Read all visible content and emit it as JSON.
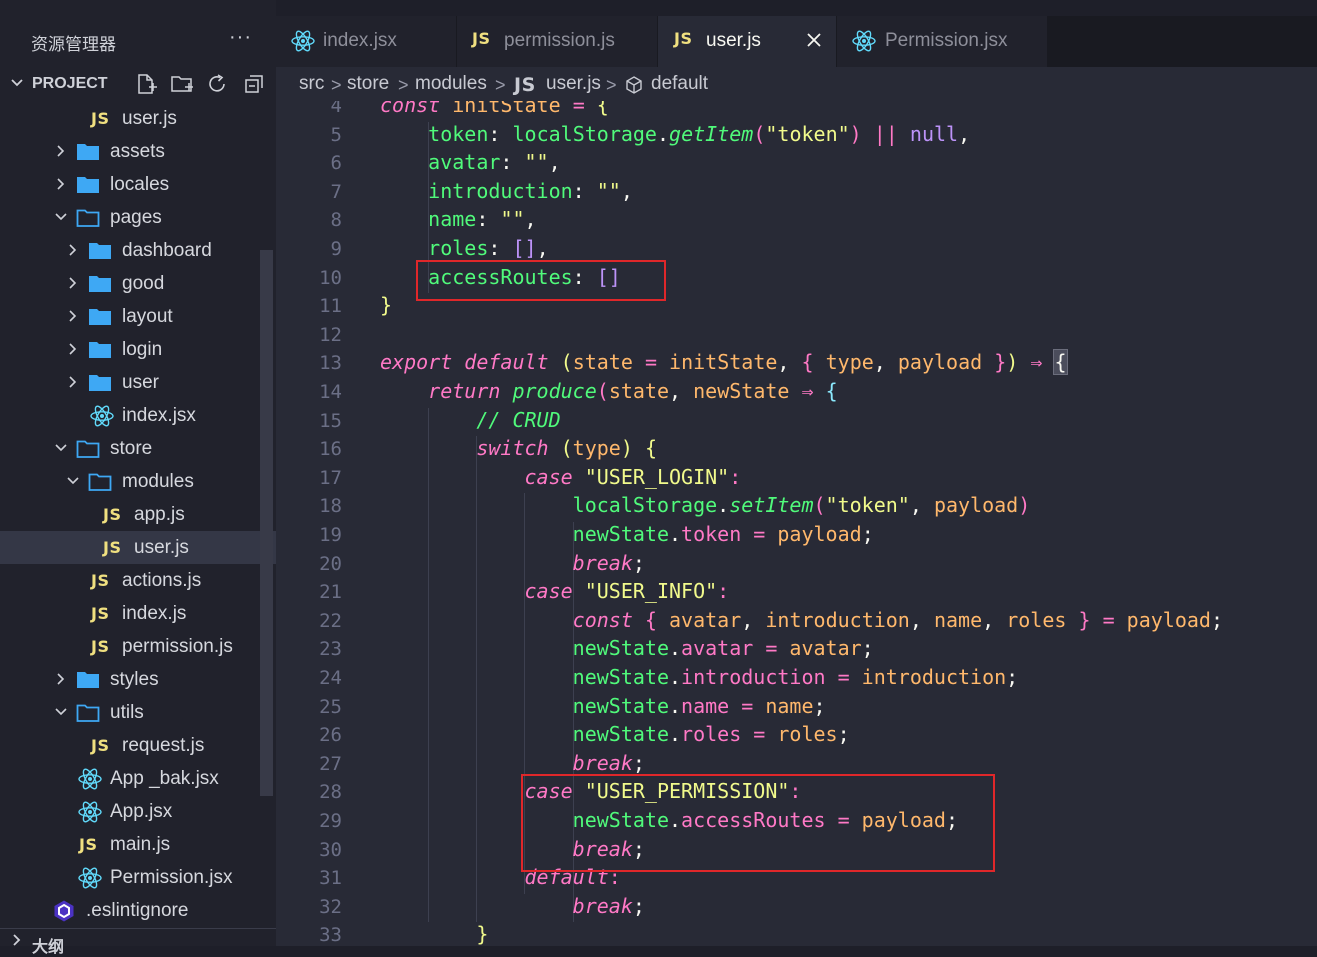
{
  "sidebar": {
    "title": "资源管理器",
    "more": "···",
    "project": "PROJECT",
    "outline": "大纲",
    "tree": [
      {
        "label": "user.js",
        "kind": "js",
        "depth": 2,
        "expanded": null
      },
      {
        "label": "assets",
        "kind": "folder",
        "depth": 1,
        "expanded": false
      },
      {
        "label": "locales",
        "kind": "folder",
        "depth": 1,
        "expanded": false
      },
      {
        "label": "pages",
        "kind": "folder",
        "depth": 1,
        "expanded": true
      },
      {
        "label": "dashboard",
        "kind": "folder",
        "depth": 2,
        "expanded": false
      },
      {
        "label": "good",
        "kind": "folder",
        "depth": 2,
        "expanded": false
      },
      {
        "label": "layout",
        "kind": "folder",
        "depth": 2,
        "expanded": false
      },
      {
        "label": "login",
        "kind": "folder",
        "depth": 2,
        "expanded": false
      },
      {
        "label": "user",
        "kind": "folder",
        "depth": 2,
        "expanded": false
      },
      {
        "label": "index.jsx",
        "kind": "react",
        "depth": 2,
        "expanded": null
      },
      {
        "label": "store",
        "kind": "folder",
        "depth": 1,
        "expanded": true
      },
      {
        "label": "modules",
        "kind": "folder",
        "depth": 2,
        "expanded": true
      },
      {
        "label": "app.js",
        "kind": "js",
        "depth": 3,
        "expanded": null
      },
      {
        "label": "user.js",
        "kind": "js",
        "depth": 3,
        "expanded": null,
        "selected": true
      },
      {
        "label": "actions.js",
        "kind": "js",
        "depth": 2,
        "expanded": null
      },
      {
        "label": "index.js",
        "kind": "js",
        "depth": 2,
        "expanded": null
      },
      {
        "label": "permission.js",
        "kind": "js",
        "depth": 2,
        "expanded": null
      },
      {
        "label": "styles",
        "kind": "folder",
        "depth": 1,
        "expanded": false
      },
      {
        "label": "utils",
        "kind": "folder",
        "depth": 1,
        "expanded": true
      },
      {
        "label": "request.js",
        "kind": "js",
        "depth": 2,
        "expanded": null
      },
      {
        "label": "App _bak.jsx",
        "kind": "react",
        "depth": 1,
        "expanded": null
      },
      {
        "label": "App.jsx",
        "kind": "react",
        "depth": 1,
        "expanded": null
      },
      {
        "label": "main.js",
        "kind": "js",
        "depth": 1,
        "expanded": null
      },
      {
        "label": "Permission.jsx",
        "kind": "react",
        "depth": 1,
        "expanded": null
      },
      {
        "label": ".eslintignore",
        "kind": "eslint",
        "depth": 0,
        "expanded": null
      }
    ]
  },
  "tabs": [
    {
      "label": "index.jsx",
      "kind": "react",
      "active": false
    },
    {
      "label": "permission.js",
      "kind": "js",
      "active": false
    },
    {
      "label": "user.js",
      "kind": "js",
      "active": true
    },
    {
      "label": "Permission.jsx",
      "kind": "react",
      "active": false
    }
  ],
  "js_badge": "JS",
  "breadcrumb": {
    "items": [
      "src",
      "store",
      "modules",
      "user.js",
      "default"
    ],
    "sep": ">"
  },
  "editor": {
    "line_numbers": [
      "4",
      "5",
      "6",
      "7",
      "8",
      "9",
      "10",
      "11",
      "12",
      "13",
      "14",
      "15",
      "16",
      "17",
      "18",
      "19",
      "20",
      "21",
      "22",
      "23",
      "24",
      "25",
      "26",
      "27",
      "28",
      "29",
      "30",
      "31",
      "32",
      "33"
    ],
    "lines": [
      [
        [
          "k",
          "const"
        ],
        [
          "pn",
          " "
        ],
        [
          "v",
          "initState"
        ],
        [
          "pn",
          " "
        ],
        [
          "o",
          "="
        ],
        [
          "pn",
          " "
        ],
        [
          "b1",
          "{"
        ]
      ],
      [
        [
          "pn",
          "    "
        ],
        [
          "p",
          "token"
        ],
        [
          "pn",
          ": "
        ],
        [
          "p",
          "localStorage"
        ],
        [
          "pn",
          "."
        ],
        [
          "f",
          "getItem"
        ],
        [
          "b2",
          "("
        ],
        [
          "s",
          "\"token\""
        ],
        [
          "b2",
          ")"
        ],
        [
          "pn",
          " "
        ],
        [
          "o",
          "||"
        ],
        [
          "pn",
          " "
        ],
        [
          "n",
          "null"
        ],
        [
          "pn",
          ","
        ]
      ],
      [
        [
          "pn",
          "    "
        ],
        [
          "p",
          "avatar"
        ],
        [
          "pn",
          ": "
        ],
        [
          "s",
          "\"\""
        ],
        [
          "pn",
          ","
        ]
      ],
      [
        [
          "pn",
          "    "
        ],
        [
          "p",
          "introduction"
        ],
        [
          "pn",
          ": "
        ],
        [
          "s",
          "\"\""
        ],
        [
          "pn",
          ","
        ]
      ],
      [
        [
          "pn",
          "    "
        ],
        [
          "p",
          "name"
        ],
        [
          "pn",
          ": "
        ],
        [
          "s",
          "\"\""
        ],
        [
          "pn",
          ","
        ]
      ],
      [
        [
          "pn",
          "    "
        ],
        [
          "p",
          "roles"
        ],
        [
          "pn",
          ": "
        ],
        [
          "n",
          "[]"
        ],
        [
          "pn",
          ","
        ]
      ],
      [
        [
          "pn",
          "    "
        ],
        [
          "p",
          "accessRoutes"
        ],
        [
          "pn",
          ": "
        ],
        [
          "n",
          "[]"
        ]
      ],
      [
        [
          "b1",
          "}"
        ]
      ],
      [
        [
          "pn",
          ""
        ]
      ],
      [
        [
          "k",
          "export"
        ],
        [
          "pn",
          " "
        ],
        [
          "k",
          "default"
        ],
        [
          "pn",
          " "
        ],
        [
          "b1",
          "("
        ],
        [
          "v",
          "state"
        ],
        [
          "pn",
          " "
        ],
        [
          "o",
          "="
        ],
        [
          "pn",
          " "
        ],
        [
          "v",
          "initState"
        ],
        [
          "pn",
          ", "
        ],
        [
          "b2",
          "{"
        ],
        [
          "pn",
          " "
        ],
        [
          "v",
          "type"
        ],
        [
          "pn",
          ", "
        ],
        [
          "v",
          "payload"
        ],
        [
          "pn",
          " "
        ],
        [
          "b2",
          "}"
        ],
        [
          "b1",
          ")"
        ],
        [
          "pn",
          " "
        ],
        [
          "o",
          "⇒"
        ],
        [
          "pn",
          " "
        ],
        [
          "cbr",
          "{"
        ]
      ],
      [
        [
          "pn",
          "    "
        ],
        [
          "k",
          "return"
        ],
        [
          "pn",
          " "
        ],
        [
          "f",
          "produce"
        ],
        [
          "b2",
          "("
        ],
        [
          "v",
          "state"
        ],
        [
          "pn",
          ", "
        ],
        [
          "v",
          "newState"
        ],
        [
          "pn",
          " "
        ],
        [
          "o",
          "⇒"
        ],
        [
          "pn",
          " "
        ],
        [
          "b3",
          "{"
        ]
      ],
      [
        [
          "pn",
          "        "
        ],
        [
          "c",
          "// CRUD"
        ]
      ],
      [
        [
          "pn",
          "        "
        ],
        [
          "k",
          "switch"
        ],
        [
          "pn",
          " "
        ],
        [
          "b1",
          "("
        ],
        [
          "v",
          "type"
        ],
        [
          "b1",
          ")"
        ],
        [
          "pn",
          " "
        ],
        [
          "b1",
          "{"
        ]
      ],
      [
        [
          "pn",
          "            "
        ],
        [
          "k",
          "case"
        ],
        [
          "pn",
          " "
        ],
        [
          "s",
          "\"USER_LOGIN\""
        ],
        [
          "o",
          ":"
        ]
      ],
      [
        [
          "pn",
          "                "
        ],
        [
          "p",
          "localStorage"
        ],
        [
          "pn",
          "."
        ],
        [
          "f",
          "setItem"
        ],
        [
          "b2",
          "("
        ],
        [
          "s",
          "\"token\""
        ],
        [
          "pn",
          ", "
        ],
        [
          "v",
          "payload"
        ],
        [
          "b2",
          ")"
        ]
      ],
      [
        [
          "pn",
          "                "
        ],
        [
          "p",
          "newState"
        ],
        [
          "pn",
          "."
        ],
        [
          "prop",
          "token"
        ],
        [
          "pn",
          " "
        ],
        [
          "o",
          "="
        ],
        [
          "pn",
          " "
        ],
        [
          "v",
          "payload"
        ],
        [
          "pn",
          ";"
        ]
      ],
      [
        [
          "pn",
          "                "
        ],
        [
          "k",
          "break"
        ],
        [
          "pn",
          ";"
        ]
      ],
      [
        [
          "pn",
          "            "
        ],
        [
          "k",
          "case"
        ],
        [
          "pn",
          " "
        ],
        [
          "s",
          "\"USER_INFO\""
        ],
        [
          "o",
          ":"
        ]
      ],
      [
        [
          "pn",
          "                "
        ],
        [
          "k",
          "const"
        ],
        [
          "pn",
          " "
        ],
        [
          "b2",
          "{"
        ],
        [
          "pn",
          " "
        ],
        [
          "v",
          "avatar"
        ],
        [
          "pn",
          ", "
        ],
        [
          "v",
          "introduction"
        ],
        [
          "pn",
          ", "
        ],
        [
          "v",
          "name"
        ],
        [
          "pn",
          ", "
        ],
        [
          "v",
          "roles"
        ],
        [
          "pn",
          " "
        ],
        [
          "b2",
          "}"
        ],
        [
          "pn",
          " "
        ],
        [
          "o",
          "="
        ],
        [
          "pn",
          " "
        ],
        [
          "v",
          "payload"
        ],
        [
          "pn",
          ";"
        ]
      ],
      [
        [
          "pn",
          "                "
        ],
        [
          "p",
          "newState"
        ],
        [
          "pn",
          "."
        ],
        [
          "prop",
          "avatar"
        ],
        [
          "pn",
          " "
        ],
        [
          "o",
          "="
        ],
        [
          "pn",
          " "
        ],
        [
          "v",
          "avatar"
        ],
        [
          "pn",
          ";"
        ]
      ],
      [
        [
          "pn",
          "                "
        ],
        [
          "p",
          "newState"
        ],
        [
          "pn",
          "."
        ],
        [
          "prop",
          "introduction"
        ],
        [
          "pn",
          " "
        ],
        [
          "o",
          "="
        ],
        [
          "pn",
          " "
        ],
        [
          "v",
          "introduction"
        ],
        [
          "pn",
          ";"
        ]
      ],
      [
        [
          "pn",
          "                "
        ],
        [
          "p",
          "newState"
        ],
        [
          "pn",
          "."
        ],
        [
          "prop",
          "name"
        ],
        [
          "pn",
          " "
        ],
        [
          "o",
          "="
        ],
        [
          "pn",
          " "
        ],
        [
          "v",
          "name"
        ],
        [
          "pn",
          ";"
        ]
      ],
      [
        [
          "pn",
          "                "
        ],
        [
          "p",
          "newState"
        ],
        [
          "pn",
          "."
        ],
        [
          "prop",
          "roles"
        ],
        [
          "pn",
          " "
        ],
        [
          "o",
          "="
        ],
        [
          "pn",
          " "
        ],
        [
          "v",
          "roles"
        ],
        [
          "pn",
          ";"
        ]
      ],
      [
        [
          "pn",
          "                "
        ],
        [
          "k",
          "break"
        ],
        [
          "pn",
          ";"
        ]
      ],
      [
        [
          "pn",
          "            "
        ],
        [
          "k",
          "case"
        ],
        [
          "pn",
          " "
        ],
        [
          "s",
          "\"USER_PERMISSION\""
        ],
        [
          "o",
          ":"
        ]
      ],
      [
        [
          "pn",
          "                "
        ],
        [
          "p",
          "newState"
        ],
        [
          "pn",
          "."
        ],
        [
          "prop",
          "accessRoutes"
        ],
        [
          "pn",
          " "
        ],
        [
          "o",
          "="
        ],
        [
          "pn",
          " "
        ],
        [
          "v",
          "payload"
        ],
        [
          "pn",
          ";"
        ]
      ],
      [
        [
          "pn",
          "                "
        ],
        [
          "k",
          "break"
        ],
        [
          "pn",
          ";"
        ]
      ],
      [
        [
          "pn",
          "            "
        ],
        [
          "k",
          "default"
        ],
        [
          "o",
          ":"
        ]
      ],
      [
        [
          "pn",
          "                "
        ],
        [
          "k",
          "break"
        ],
        [
          "pn",
          ";"
        ]
      ],
      [
        [
          "pn",
          "        "
        ],
        [
          "b1",
          "}"
        ]
      ]
    ]
  },
  "colors": {
    "highlight_box": "#e0272a",
    "js_badge": "#f0e080",
    "react_icon": "#61dafb",
    "folder": "#3ea8f4"
  }
}
